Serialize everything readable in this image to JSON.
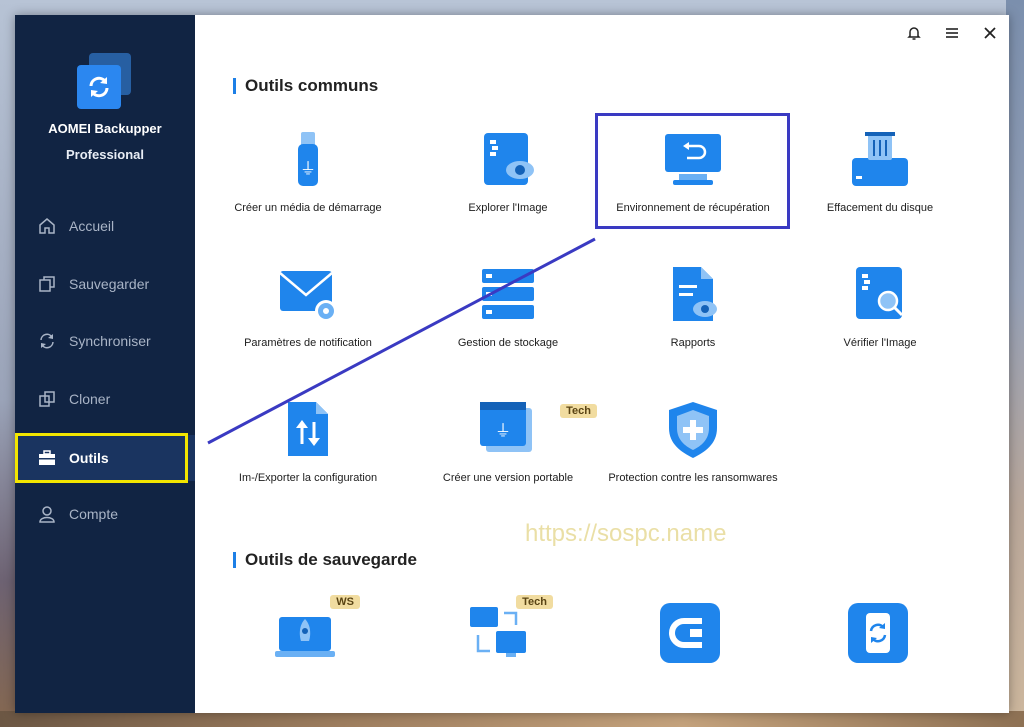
{
  "app": {
    "name": "AOMEI Backupper",
    "edition": "Professional"
  },
  "sidebar": {
    "items": [
      {
        "label": "Accueil",
        "icon": "home-icon"
      },
      {
        "label": "Sauvegarder",
        "icon": "copy-icon"
      },
      {
        "label": "Synchroniser",
        "icon": "sync-icon"
      },
      {
        "label": "Cloner",
        "icon": "clone-icon"
      },
      {
        "label": "Outils",
        "icon": "toolbox-icon"
      },
      {
        "label": "Compte",
        "icon": "user-icon"
      }
    ],
    "active": "Outils"
  },
  "topbar": {
    "buttons": [
      "bell-icon",
      "menu-icon",
      "close-icon"
    ]
  },
  "sections": {
    "common": {
      "title": "Outils communs",
      "tools": [
        {
          "label": "Créer un média de démarrage",
          "icon": "usb-drive-icon"
        },
        {
          "label": "Explorer l'Image",
          "icon": "explore-image-icon"
        },
        {
          "label": "Environnement de récupération",
          "icon": "recovery-monitor-icon"
        },
        {
          "label": "Effacement du disque",
          "icon": "disk-wipe-icon"
        },
        {
          "label": "Paramètres de notification",
          "icon": "mail-settings-icon"
        },
        {
          "label": "Gestion de stockage",
          "icon": "storage-server-icon"
        },
        {
          "label": "Rapports",
          "icon": "report-icon"
        },
        {
          "label": "Vérifier l'Image",
          "icon": "check-image-icon"
        },
        {
          "label": "Im-/Exporter la configuration",
          "icon": "import-export-icon"
        },
        {
          "label": "Créer une version portable",
          "icon": "portable-version-icon",
          "badge": "Tech"
        },
        {
          "label": "Protection contre les ransomwares",
          "icon": "shield-plus-icon"
        }
      ]
    },
    "backup": {
      "title": "Outils de sauvegarde",
      "tools": [
        {
          "icon": "rocket-laptop-icon",
          "badge": "WS"
        },
        {
          "icon": "pc-to-pc-icon",
          "badge": "Tech"
        },
        {
          "icon": "cbackup-icon"
        },
        {
          "icon": "phone-sync-icon"
        }
      ]
    }
  },
  "watermark": "https://sospc.name",
  "colors": {
    "sidebar": "#112443",
    "accent": "#1d7fe6",
    "highlight_yellow": "#f3e600",
    "highlight_blue": "#3a3ac2"
  }
}
